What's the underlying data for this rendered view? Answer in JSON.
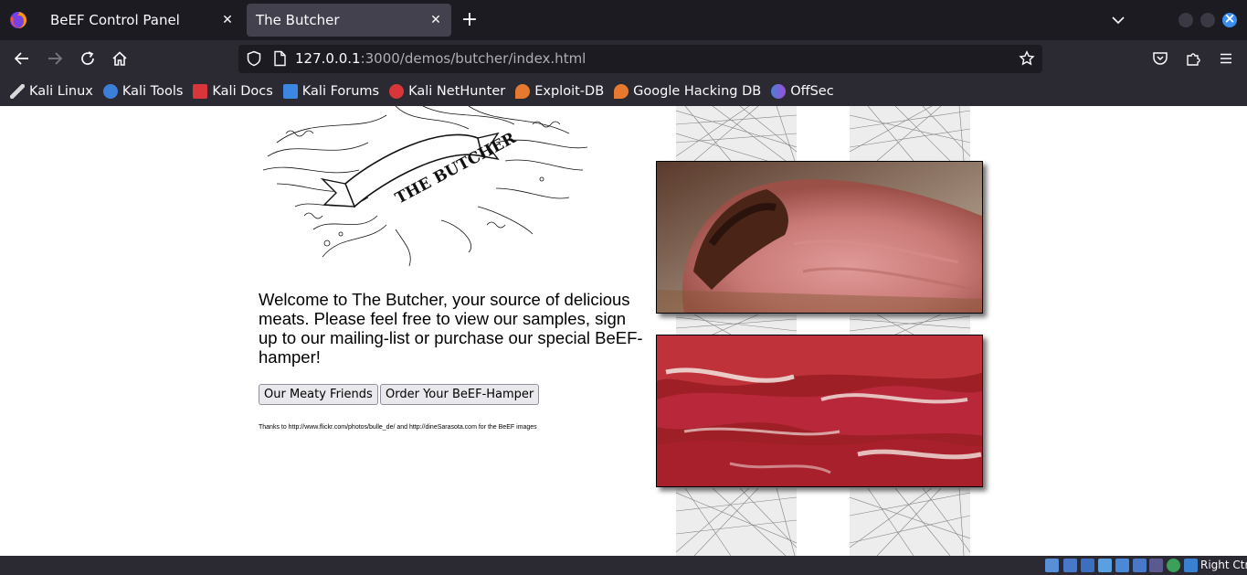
{
  "browser": {
    "tabs": [
      {
        "title": "BeEF Control Panel",
        "active": false
      },
      {
        "title": "The Butcher",
        "active": true
      }
    ],
    "url": {
      "host": "127.0.0.1",
      "path": ":3000/demos/butcher/index.html"
    },
    "bookmarks": [
      {
        "label": "Kali Linux",
        "icon": "kali-dragon-icon",
        "color": "#d8d8d8"
      },
      {
        "label": "Kali Tools",
        "icon": "kali-tools-icon",
        "color": "#3d7fd8"
      },
      {
        "label": "Kali Docs",
        "icon": "kali-docs-icon",
        "color": "#d8363b"
      },
      {
        "label": "Kali Forums",
        "icon": "kali-forums-icon",
        "color": "#3b86e0"
      },
      {
        "label": "Kali NetHunter",
        "icon": "nethunter-icon",
        "color": "#d8363b"
      },
      {
        "label": "Exploit-DB",
        "icon": "exploit-db-icon",
        "color": "#e6792f"
      },
      {
        "label": "Google Hacking DB",
        "icon": "ghdb-icon",
        "color": "#e6792f"
      },
      {
        "label": "OffSec",
        "icon": "offsec-icon",
        "color": "#4d7fd8"
      }
    ]
  },
  "page": {
    "logo_text": "THE BUTCHER",
    "welcome": "Welcome to The Butcher, your source of delicious meats. Please feel free to view our samples, sign up to our mailing-list or purchase our special BeEF-hamper!",
    "buttons": {
      "friends": "Our Meaty Friends",
      "hamper": "Order Your BeEF-Hamper"
    },
    "thanks": "Thanks to http://www.flickr.com/photos/bulle_de/ and http://dineSarasota.com for the BeEF images"
  },
  "tray": {
    "host_key": "Right Ctrl"
  }
}
